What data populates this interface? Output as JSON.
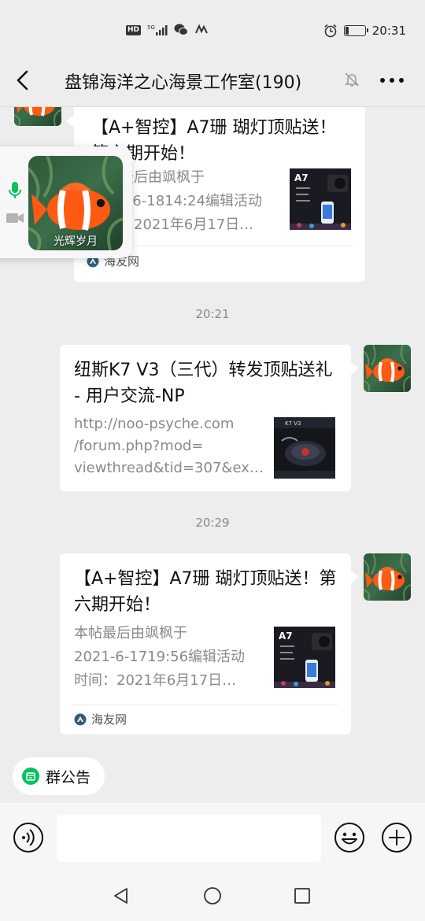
{
  "status_bar": {
    "hd": "HD",
    "network": "5G",
    "time": "20:31",
    "battery_level": 0.15
  },
  "header": {
    "title": "盘锦海洋之心海景工作室(190)"
  },
  "float_call": {
    "name": "光辉岁月"
  },
  "messages": [
    {
      "title": "【A+智控】A7珊 瑚灯顶贴送！第六期开始！",
      "desc": [
        "本帖最后由飒枫于",
        "2021-6-1814:24编辑活动",
        "时间：2021年6月17日…"
      ],
      "thumb_icon": "A7-light-product-thumbnail",
      "source": "海友网"
    },
    {
      "time": "20:21",
      "title": "纽斯K7 V3（三代）转发顶贴送礼 - 用户交流-NP",
      "desc": [
        "http://noo-psyche.com",
        "/forum.php?mod=",
        "viewthread&tid=307&ex…"
      ],
      "thumb_icon": "K7-product-thumbnail"
    },
    {
      "time": "20:29",
      "title": "【A+智控】A7珊 瑚灯顶贴送！第六期开始！",
      "desc": [
        "本帖最后由飒枫于",
        "2021-6-1719:56编辑活动",
        "时间：2021年6月17日…"
      ],
      "thumb_icon": "A7-light-product-thumbnail",
      "source": "海友网"
    }
  ],
  "announcement": {
    "label": "群公告"
  },
  "input": {
    "value": ""
  },
  "colors": {
    "background": "#ededed",
    "card": "#ffffff",
    "muted_text": "#8a8a8a",
    "mic_green": "#07c160"
  }
}
